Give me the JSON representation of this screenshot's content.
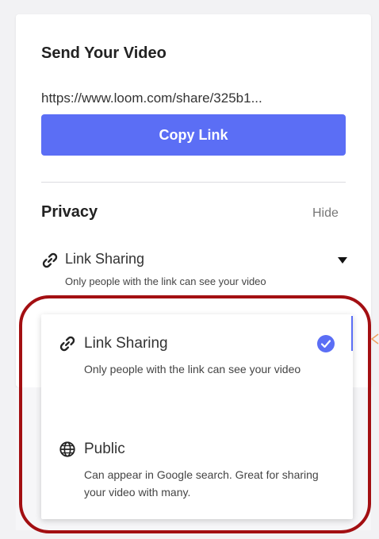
{
  "send": {
    "title": "Send Your Video",
    "share_url": "https://www.loom.com/share/325b1...",
    "copy_button_label": "Copy Link"
  },
  "privacy": {
    "title": "Privacy",
    "hide_label": "Hide",
    "selected": {
      "icon": "link-icon",
      "label": "Link Sharing",
      "description": "Only people with the link can see your video"
    },
    "options": [
      {
        "icon": "link-icon",
        "label": "Link Sharing",
        "description": "Only people with the link can see your video",
        "selected": true
      },
      {
        "icon": "globe-icon",
        "label": "Public",
        "description": "Can appear in Google search. Great for sharing your video with many.",
        "selected": false
      }
    ]
  },
  "colors": {
    "accent": "#5b6ef5",
    "highlight": "#a30f12",
    "arrow": "#f0a060"
  }
}
